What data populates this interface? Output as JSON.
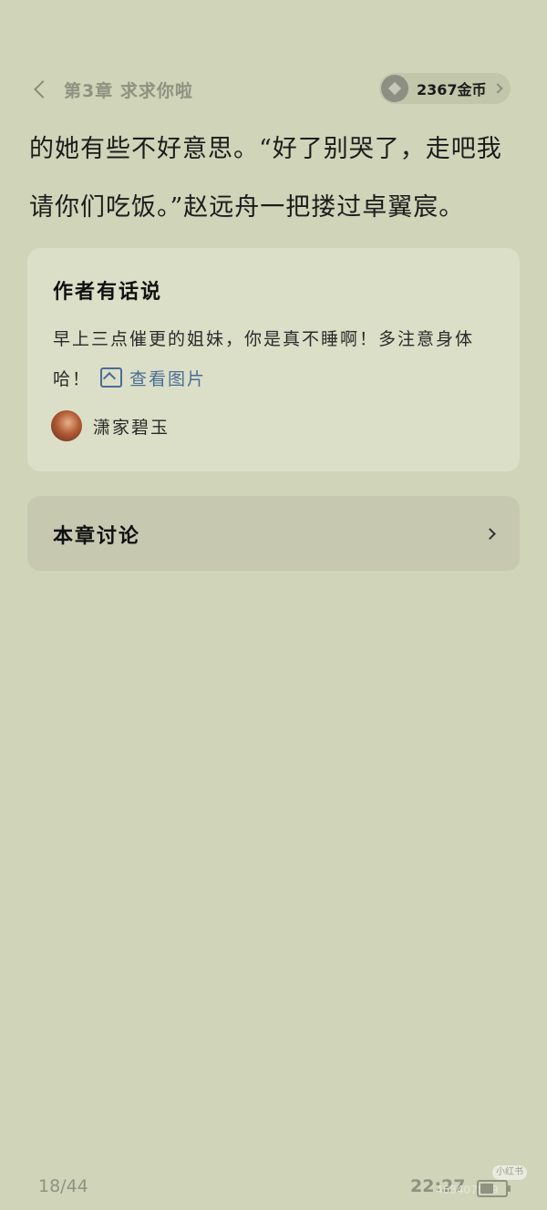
{
  "header": {
    "chapter_title": "第3章 求求你啦",
    "coins_label": "2367金币"
  },
  "body_text": {
    "line1": "的她有些不好意思。“好了别哭了，走吧我",
    "line2": "请你们吃饭。”赵远舟一把搂过卓翼宸。"
  },
  "author_note": {
    "heading": "作者有话说",
    "text": "早上三点催更的姐妹，你是真不睡啊！多注意身体哈！",
    "view_image_label": "查看图片",
    "author_name": "潇家碧玉"
  },
  "discussion": {
    "label": "本章讨论"
  },
  "footer": {
    "page_progress": "18/44",
    "time": "22:27"
  },
  "watermark": {
    "badge": "小红书",
    "id": "468407859"
  }
}
